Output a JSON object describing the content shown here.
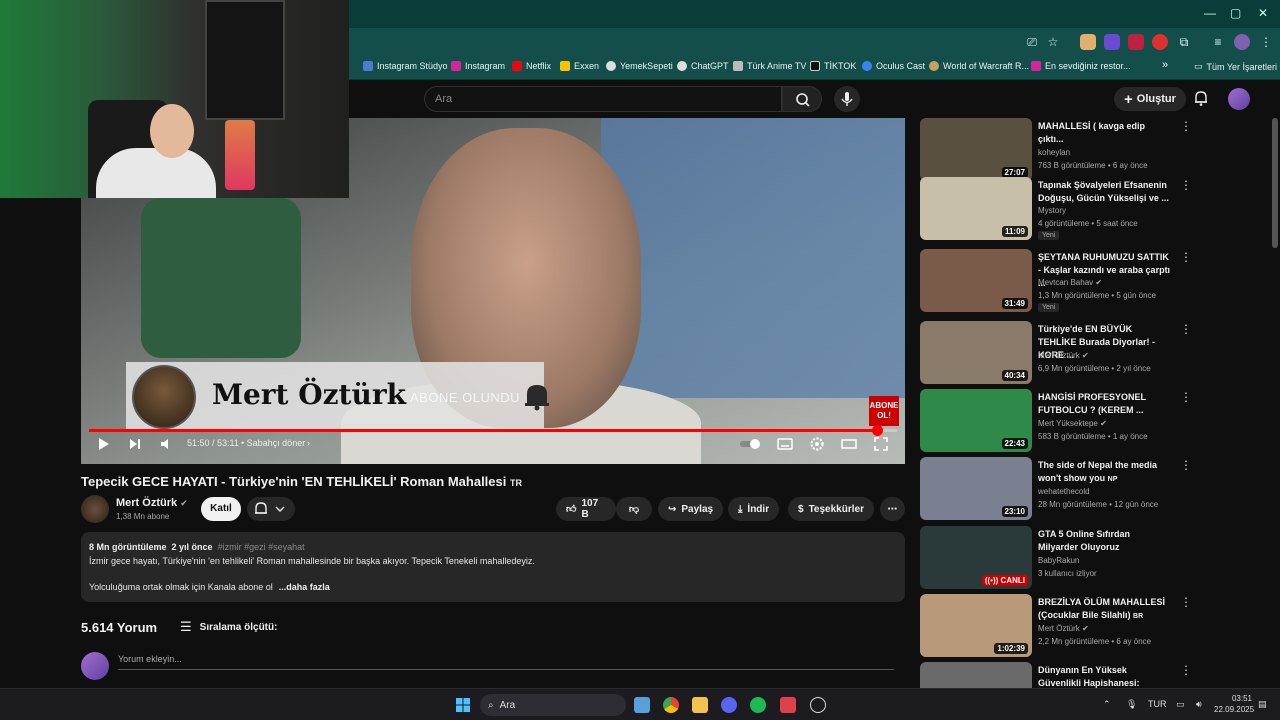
{
  "browser": {
    "bookmarks": [
      {
        "label": "Instagram Stüdyo",
        "color": "#4a7bd1"
      },
      {
        "label": "Instagram",
        "color": "#d6249f"
      },
      {
        "label": "Netflix",
        "color": "#e50914"
      },
      {
        "label": "Exxen",
        "color": "#f5c400"
      },
      {
        "label": "YemekSepeti",
        "color": "#dddddd"
      },
      {
        "label": "ChatGPT",
        "color": "#dddddd"
      },
      {
        "label": "Türk Anime TV",
        "color": "#bbbbbb"
      },
      {
        "label": "TİKTOK",
        "color": "#111111"
      },
      {
        "label": "Oculus Cast",
        "color": "#3b82f6"
      },
      {
        "label": "World of Warcraft R...",
        "color": "#c8a060"
      },
      {
        "label": "En sevdiğiniz restor...",
        "color": "#d6249f"
      }
    ],
    "more_bookmarks": "»",
    "all_bookmarks": "Tüm Yer İşaretleri"
  },
  "header": {
    "search_placeholder": "Ara",
    "create_label": "Oluştur"
  },
  "player": {
    "overlay_name": "Mert Öztürk",
    "overlay_subscribed": "ABONE OLUNDU",
    "abone_ol": "ABONE OL!",
    "time": "51:50 / 53:11",
    "chapter": "• Sabahçı döner",
    "progress_fraction": 0.975
  },
  "video": {
    "title": "Tepecik GECE HAYATI - Türkiye'nin 'EN TEHLİKELİ' Roman Mahallesi",
    "title_badge": "TR",
    "channel_name": "Mert Öztürk",
    "subscribers": "1,38 Mn abone",
    "join_label": "Katıl",
    "likes": "107 B",
    "share_label": "Paylaş",
    "download_label": "İndir",
    "thanks_label": "Teşekkürler"
  },
  "description": {
    "views": "8 Mn görüntüleme",
    "age": "2 yıl önce",
    "tags": "#izmir #gezi #seyahat",
    "line1": "İzmir gece hayatı, Türkiye'nin 'en tehlikeli' Roman mahallesinde bir başka akıyor. Tepecik Tenekeli mahalledeyiz.",
    "line2": "Yolculuğuma ortak olmak için Kanala abone ol",
    "more": "...daha fazla"
  },
  "comments": {
    "count": "5.614 Yorum",
    "sort_label": "Sıralama ölçütü:",
    "add_placeholder": "Yorum ekleyin..."
  },
  "sidebar": {
    "items": [
      {
        "title": "MAHALLESİ ( kavga edip çıktı...",
        "channel": "koheylan",
        "stats": "763 B görüntüleme • 6 ay önce",
        "duration": "27:07",
        "badge": "",
        "thumb": "#5a5040"
      },
      {
        "title": "Tapınak Şövalyeleri Efsanenin Doğuşu, Gücün Yükselişi ve ...",
        "channel": "Mystory",
        "stats": "4 görüntüleme • 5 saat önce",
        "duration": "11:09",
        "badge": "Yeni",
        "thumb": "#c8bfa8"
      },
      {
        "title": "ŞEYTANA RUHUMUZU SATTIK - Kaşlar kazındı ve araba çarptı ...",
        "channel": "Mevtcan Bahav",
        "stats": "1,3 Mn görüntüleme • 5 gün önce",
        "duration": "31:49",
        "badge": "Yeni",
        "thumb": "#7a5a48"
      },
      {
        "title": "Türkiye'de EN BÜYÜK TEHLİKE Burada Diyorlar! - KORE ...",
        "channel": "Mert Öztürk",
        "stats": "6,9 Mn görüntüleme • 2 yıl önce",
        "duration": "40:34",
        "badge": "",
        "thumb": "#8a7a6a"
      },
      {
        "title": "HANGİSİ PROFESYONEL FUTBOLCU ?  (KEREM ...",
        "channel": "Mert Yüksektepe",
        "stats": "583 B görüntüleme • 1 ay önce",
        "duration": "22:43",
        "badge": "",
        "thumb": "#2f8a4a"
      },
      {
        "title": "The side of Nepal the media won't show you",
        "title_badge": "NP",
        "channel": "wehatethecold",
        "stats": "28 Mn görüntüleme • 12 gün önce",
        "duration": "23:10",
        "badge": "",
        "thumb": "#7a8090"
      },
      {
        "title": "GTA 5 Online Sıfırdan Milyarder Oluyoruz",
        "channel": "BabyRakun",
        "stats": "3 kullanıcı izliyor",
        "duration": "",
        "live": "CANLI",
        "badge": "",
        "thumb": "#2a3a3a"
      },
      {
        "title": "BREZİLYA ÖLÜM MAHALLESİ (Çocuklar Bile Silahlı)",
        "title_badge": "BR",
        "channel": "Mert Öztürk",
        "stats": "2,2 Mn görüntüleme • 6 ay önce",
        "duration": "1:02:39",
        "badge": "",
        "thumb": "#b89a7a"
      },
      {
        "title": "Dünyanın En Yüksek Güvenlikli Hapishanesi: CECOT (Şeytanla...",
        "channel": "",
        "stats": "",
        "duration": "",
        "badge": "",
        "thumb": "#6a6a6a"
      }
    ]
  },
  "taskbar": {
    "search_label": "Ara",
    "language": "TUR",
    "time": "03:51",
    "date": "22.09.2025"
  }
}
